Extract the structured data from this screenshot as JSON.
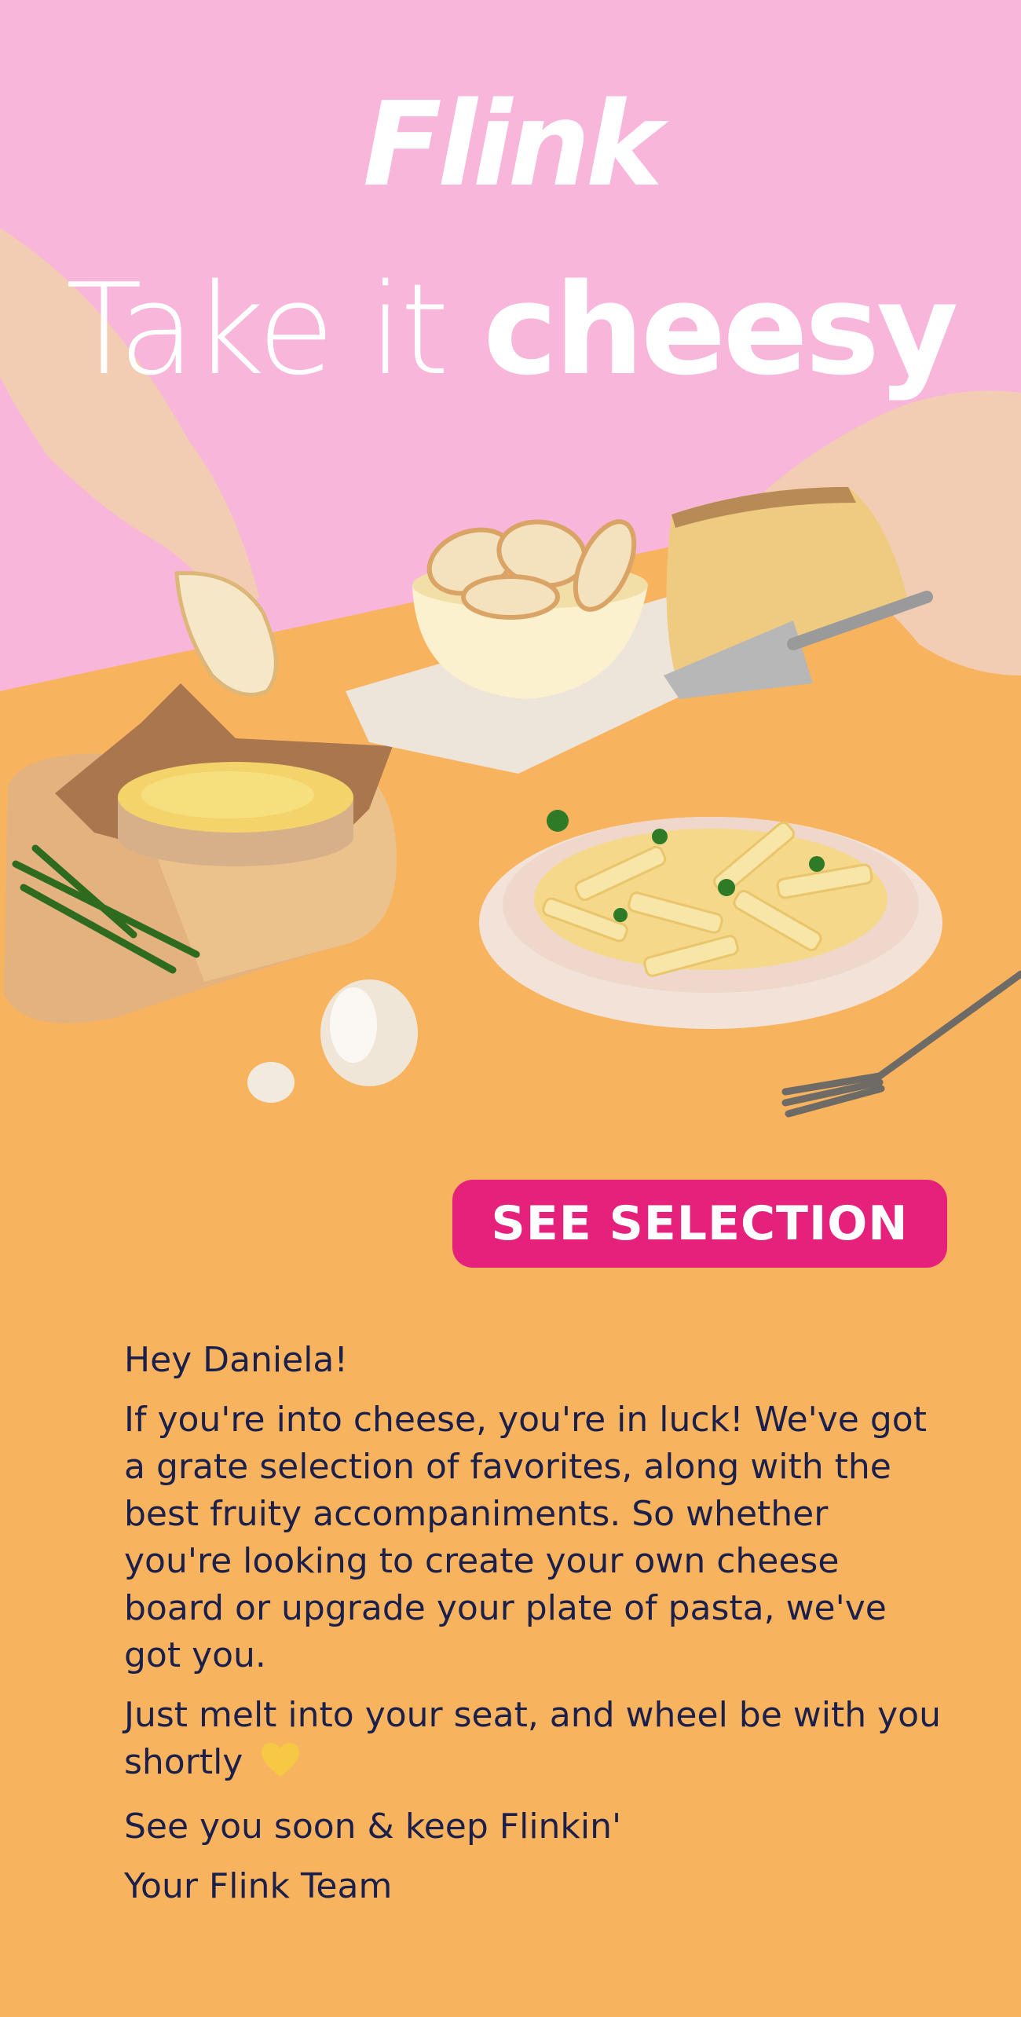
{
  "brand": {
    "logo_text": "Flink",
    "colors": {
      "pink_bg": "#F7B6DA",
      "orange_bg": "#F8B35E",
      "cta": "#E6217B",
      "text": "#1B1F4B"
    }
  },
  "hero": {
    "headline_light": "Take it",
    "headline_bold": "cheesy"
  },
  "cta": {
    "label": "SEE SELECTION"
  },
  "message": {
    "greeting": "Hey Daniela!",
    "paragraph_1": "If you're into cheese, you're in luck! We've got a grate selection of favorites, along with the best fruity accompaniments. So whether you're looking to create your own cheese board or upgrade your plate of pasta, we've got you.",
    "paragraph_2": "Just melt into your seat, and wheel be with you shortly",
    "heart_icon": "yellow-heart-icon",
    "sign_off": "See you soon & keep Flinkin'",
    "signature": "Your Flink Team"
  }
}
